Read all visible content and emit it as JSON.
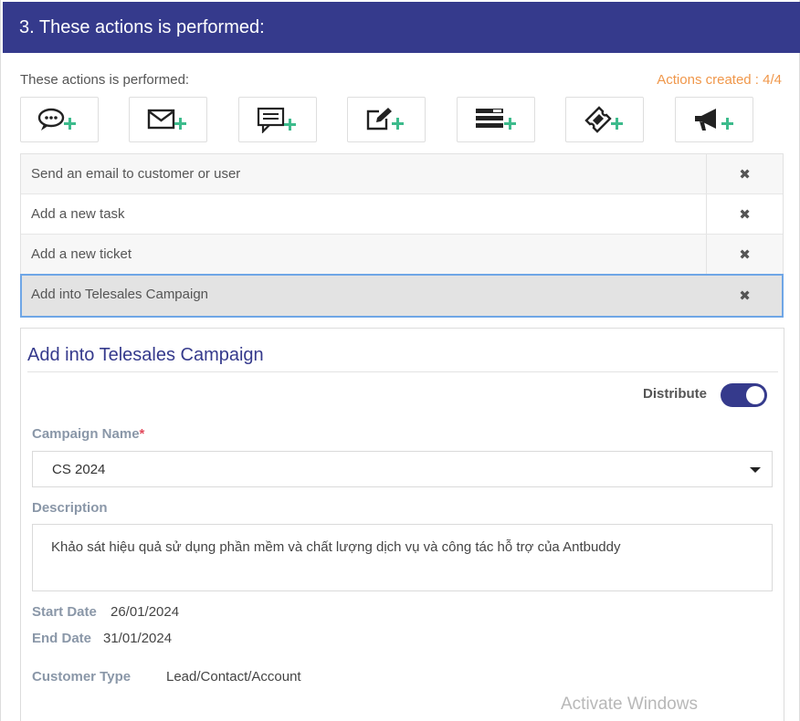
{
  "header": {
    "title": "3. These actions is performed:"
  },
  "actions_bar": {
    "label": "These actions is performed:",
    "created_text": "Actions created : 4/4",
    "buttons": [
      {
        "icon": "chat-bubble-add-icon"
      },
      {
        "icon": "envelope-add-icon"
      },
      {
        "icon": "message-add-icon"
      },
      {
        "icon": "edit-add-icon"
      },
      {
        "icon": "list-add-icon"
      },
      {
        "icon": "ticket-add-icon"
      },
      {
        "icon": "megaphone-add-icon"
      }
    ]
  },
  "action_list": [
    {
      "label": "Send an email to customer or user",
      "remove": "✖"
    },
    {
      "label": "Add a new task",
      "remove": "✖"
    },
    {
      "label": "Add a new ticket",
      "remove": "✖"
    },
    {
      "label": "Add into Telesales Campaign",
      "remove": "✖"
    }
  ],
  "detail": {
    "title": "Add into Telesales Campaign",
    "distribute_label": "Distribute",
    "distribute_on": true,
    "campaign_label": "Campaign Name",
    "required_mark": "*",
    "campaign_value": "CS 2024",
    "description_label": "Description",
    "description_value": "Khảo sát hiệu quả sử dụng phần mềm và chất lượng dịch vụ và công tác hỗ trợ của Antbuddy",
    "start_label": "Start Date",
    "start_value": "26/01/2024",
    "end_label": "End Date",
    "end_value": "31/01/2024",
    "customer_type_label": "Customer Type",
    "customer_type_value": "Lead/Contact/Account"
  },
  "watermark": "Activate Windows",
  "colors": {
    "header_bg": "#353a8c",
    "accent_orange": "#f0974a",
    "plus_green": "#3dbb8c",
    "selected_outline": "#6fa6e6"
  }
}
